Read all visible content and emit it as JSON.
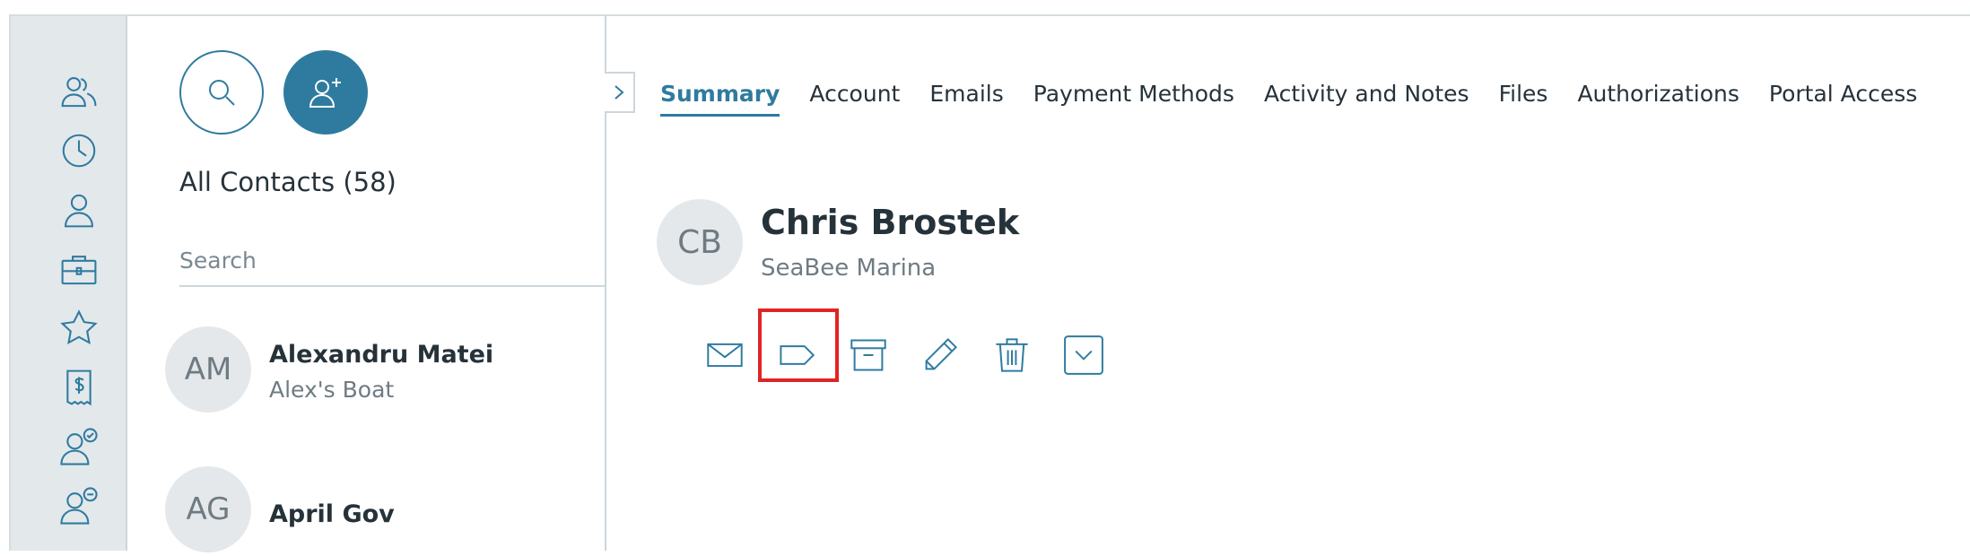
{
  "rail": {
    "icons": [
      "contacts-icon",
      "history-icon",
      "person-icon",
      "briefcase-icon",
      "star-icon",
      "invoice-icon",
      "person-check-icon",
      "person-minus-icon"
    ]
  },
  "list": {
    "title": "All Contacts (58)",
    "search_placeholder": "Search",
    "contacts": [
      {
        "initials": "AM",
        "name": "Alexandru Matei",
        "subtitle": "Alex's Boat"
      },
      {
        "initials": "AG",
        "name": "April Gov",
        "subtitle": ""
      }
    ]
  },
  "tabs": [
    "Summary",
    "Account",
    "Emails",
    "Payment Methods",
    "Activity and Notes",
    "Files",
    "Authorizations",
    "Portal Access"
  ],
  "active_tab": "Summary",
  "detail": {
    "initials": "CB",
    "name": "Chris Brostek",
    "company": "SeaBee Marina"
  },
  "actions": [
    "email-icon",
    "tag-icon",
    "archive-icon",
    "edit-icon",
    "trash-icon",
    "more-chevron-icon"
  ],
  "highlighted_action": "tag-icon",
  "colors": {
    "accent": "#2f7b9f",
    "rail_bg": "#e3e8eb",
    "highlight": "#e02424",
    "avatar_bg": "#e5e8ea"
  }
}
